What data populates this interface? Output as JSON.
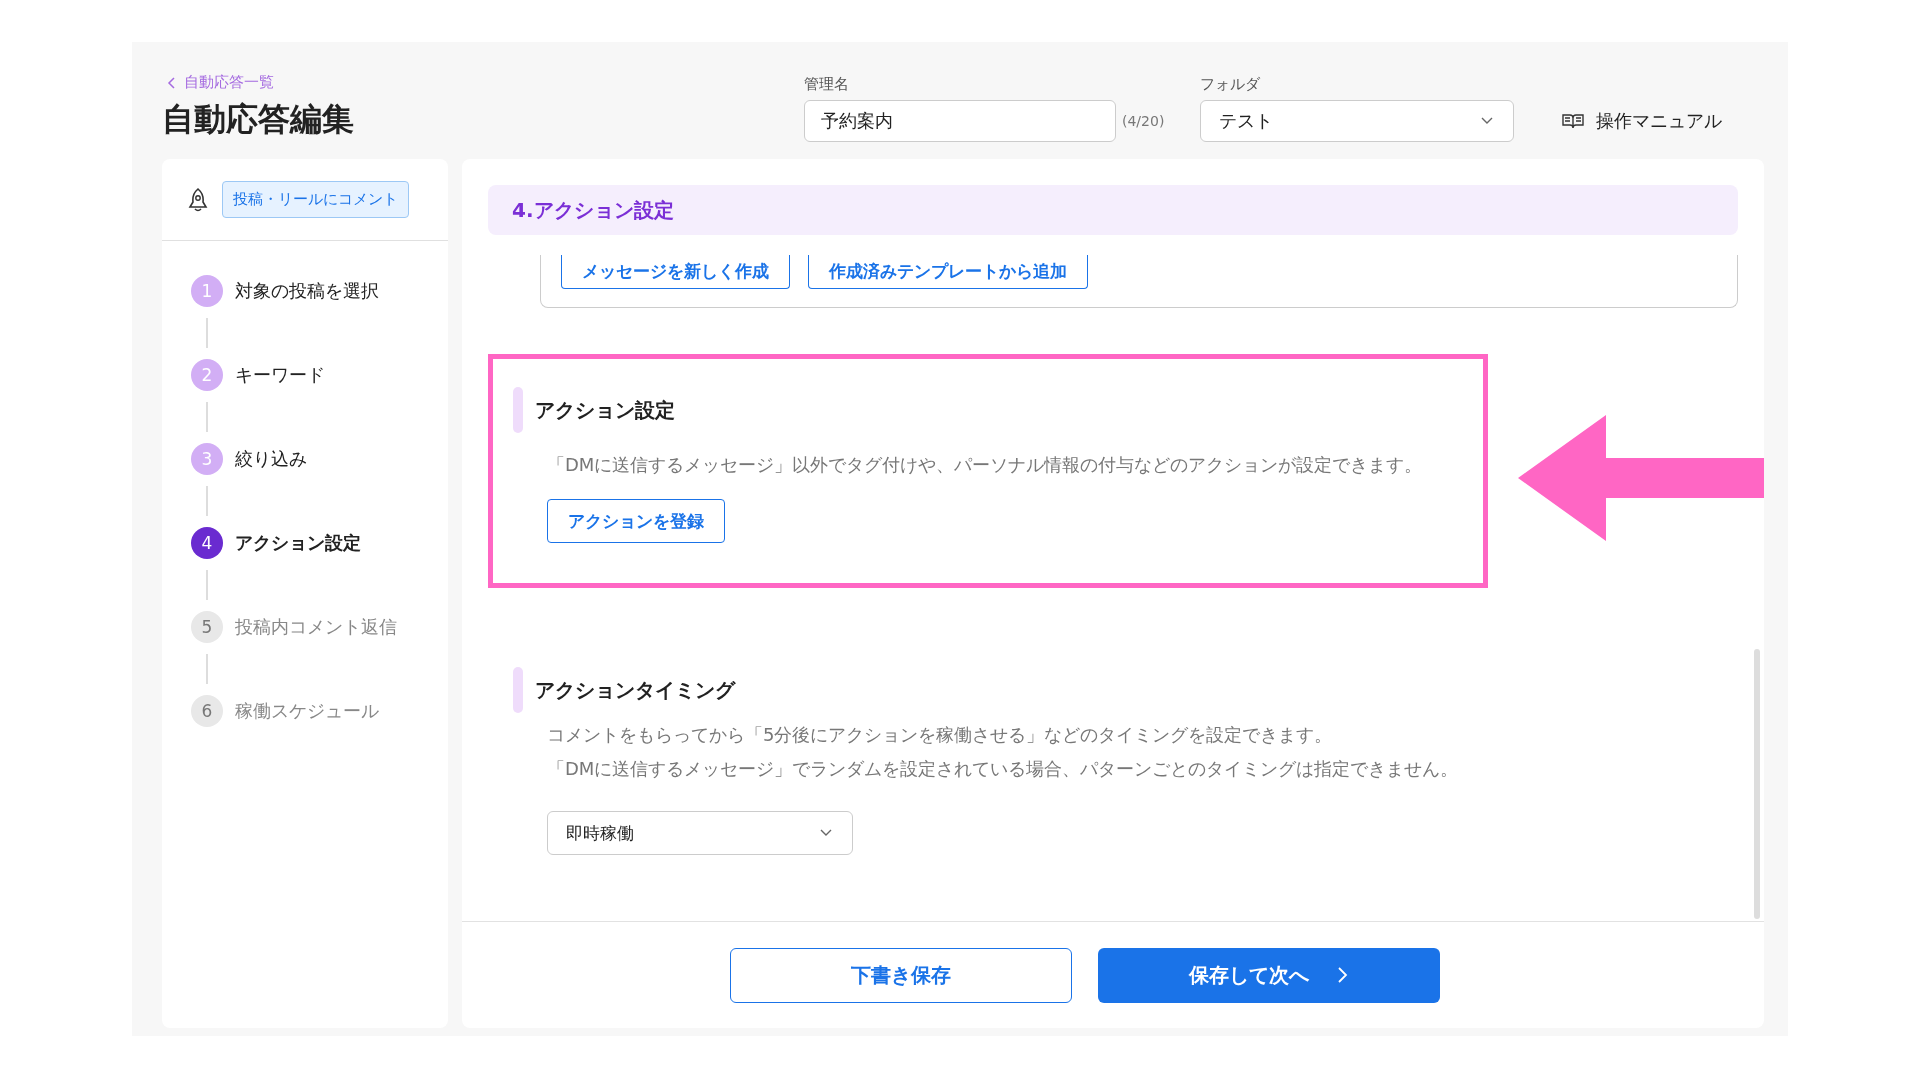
{
  "header": {
    "back_link": "自動応答一覧",
    "title": "自動応答編集",
    "name_field": {
      "label": "管理名",
      "value": "予約案内",
      "counter": "(4/20)"
    },
    "folder_field": {
      "label": "フォルダ",
      "value": "テスト"
    },
    "manual_link": "操作マニュアル"
  },
  "sidebar": {
    "trigger_tag": "投稿・リールにコメント",
    "steps": [
      {
        "number": "1",
        "label": "対象の投稿を選択",
        "completed": true,
        "selected": false
      },
      {
        "number": "2",
        "label": "キーワード",
        "completed": true,
        "selected": false
      },
      {
        "number": "3",
        "label": "絞り込み",
        "completed": true,
        "selected": false
      },
      {
        "number": "4",
        "label": "アクション設定",
        "completed": false,
        "selected": true
      },
      {
        "number": "5",
        "label": "投稿内コメント返信",
        "completed": false,
        "selected": false
      },
      {
        "number": "6",
        "label": "稼働スケジュール",
        "completed": false,
        "selected": false
      }
    ]
  },
  "main": {
    "section_title": "4.アクション設定",
    "message_buttons": [
      "メッセージを新しく作成",
      "作成済みテンプレートから追加"
    ],
    "action_section": {
      "title": "アクション設定",
      "description": "「DMに送信するメッセージ」以外でタグ付けや、パーソナル情報の付与などのアクションが設定できます。",
      "button": "アクションを登録",
      "highlighted": true
    },
    "timing_section": {
      "title": "アクションタイミング",
      "description": [
        "コメントをもらってから「5分後にアクションを稼働させる」などのタイミングを設定できます。",
        "「DMに送信するメッセージ」でランダムを設定されている場合、パターンごとのタイミングは指定できません。"
      ],
      "select_value": "即時稼働"
    },
    "footer": {
      "draft_button": "下書き保存",
      "next_button": "保存して次へ"
    }
  },
  "annotation": {
    "kind": "arrow"
  }
}
